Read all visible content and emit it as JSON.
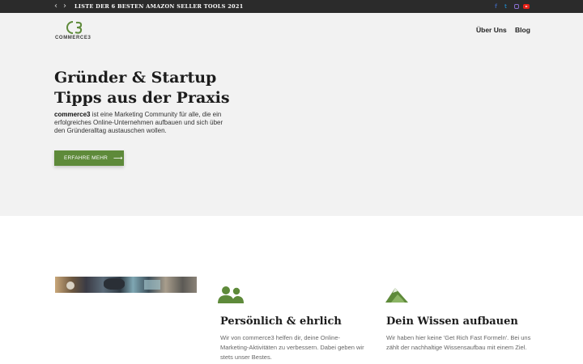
{
  "topbar": {
    "prev_icon": "chevron-left-icon",
    "next_icon": "chevron-right-icon",
    "prev_glyph": "‹",
    "next_glyph": "›",
    "news_headline": "LISTE DER 6 BESTEN AMAZON SELLER TOOLS 2021",
    "social": [
      {
        "name": "facebook-icon",
        "glyph": "f",
        "color": "#3b5998"
      },
      {
        "name": "twitter-icon",
        "glyph": "t",
        "color": "#1da1f2"
      },
      {
        "name": "instagram-icon",
        "color": "#8a6fd0"
      },
      {
        "name": "youtube-icon",
        "color": "#e62117"
      }
    ]
  },
  "header": {
    "logo_text": "COMMERCE3",
    "nav": [
      "Über Uns",
      "Blog"
    ]
  },
  "hero": {
    "title_line1": "Gründer & Startup",
    "title_line2": "Tipps aus der Praxis",
    "desc_brand": "commerce3",
    "desc_rest": " ist eine Marketing Community für alle, die ein erfolgreiches Online-Unternehmen aufbauen und sich über den Gründeralltag austauschen wollen.",
    "cta_label": "ERFAHRE MEHR",
    "cta_arrow": "⟶"
  },
  "features": [
    {
      "icon": "people-icon",
      "title": "Persönlich & ehrlich",
      "text": "Wir von commerce3 helfen dir, deine Online-Marketing-Aktivitäten zu verbessern. Dabei geben wir stets unser Bestes."
    },
    {
      "icon": "mountain-icon",
      "title": "Dein Wissen aufbauen",
      "text": "Wir haben hier keine 'Get Rich Fast Formeln'. Bei uns zählt der nachhaltige Wissensaufbau mit einem Ziel."
    }
  ],
  "colors": {
    "accent": "#5e8a3a",
    "topbar_bg": "#2b2b2b",
    "hero_bg": "#f2f2f2"
  }
}
